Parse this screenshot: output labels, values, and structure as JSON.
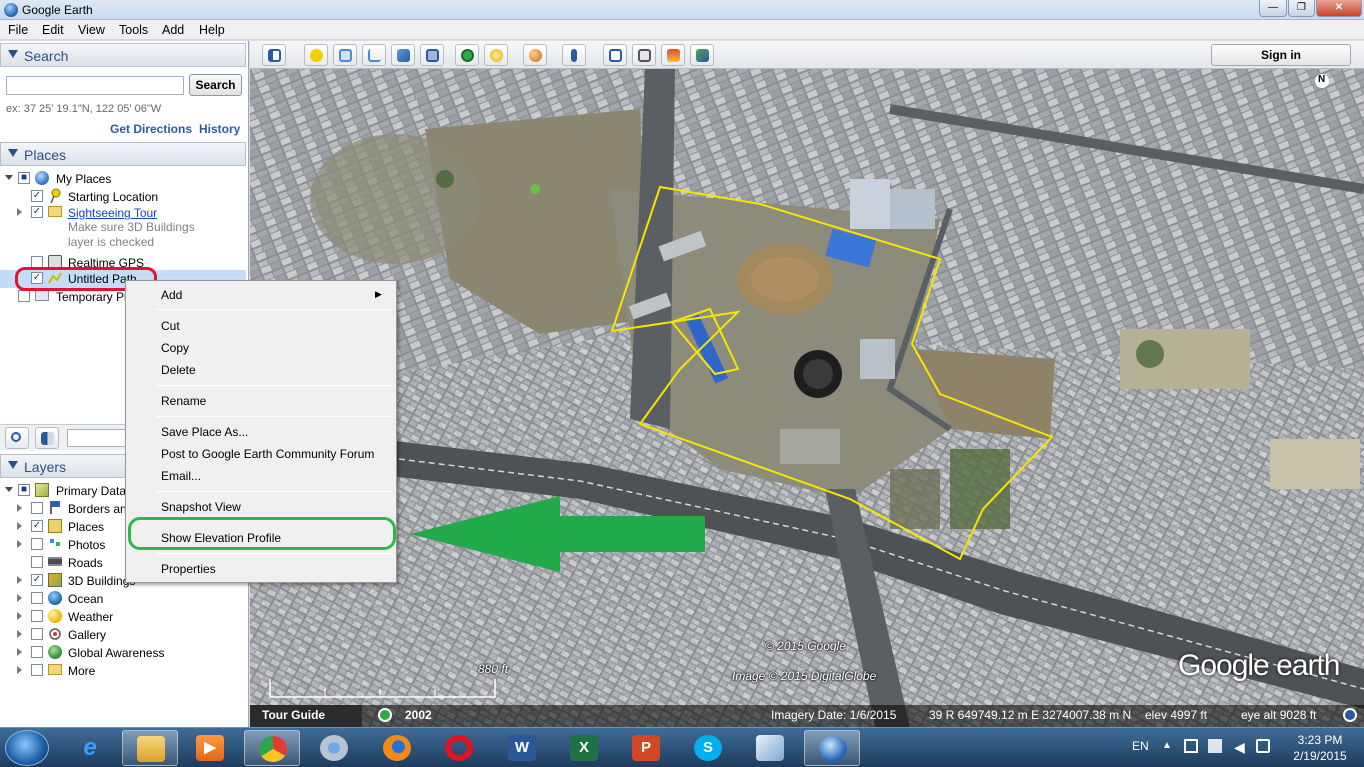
{
  "window": {
    "title": "Google Earth",
    "min": "—",
    "max": "❐",
    "close": "✕"
  },
  "menu": [
    "File",
    "Edit",
    "View",
    "Tools",
    "Add",
    "Help"
  ],
  "search": {
    "header": "Search",
    "button": "Search",
    "input_value": "",
    "hint": "ex: 37 25' 19.1\"N, 122 05' 06\"W",
    "get_directions": "Get Directions",
    "history": "History"
  },
  "places": {
    "header": "Places",
    "items": [
      {
        "label": "My Places"
      },
      {
        "label": "Starting Location"
      },
      {
        "label": "Sightseeing Tour"
      },
      {
        "label": "Make sure 3D Buildings"
      },
      {
        "label": "layer is checked"
      },
      {
        "label": "Realtime GPS"
      },
      {
        "label": "Untitled Path"
      },
      {
        "label": "Temporary Places"
      }
    ]
  },
  "layers": {
    "header": "Layers",
    "items": [
      {
        "label": "Primary Database"
      },
      {
        "label": "Borders and Labels"
      },
      {
        "label": "Places"
      },
      {
        "label": "Photos"
      },
      {
        "label": "Roads"
      },
      {
        "label": "3D Buildings"
      },
      {
        "label": "Ocean"
      },
      {
        "label": "Weather"
      },
      {
        "label": "Gallery"
      },
      {
        "label": "Global Awareness"
      },
      {
        "label": "More"
      }
    ]
  },
  "context_menu": {
    "items": [
      "Add",
      "Cut",
      "Copy",
      "Delete",
      "Rename",
      "Save Place As...",
      "Post to Google Earth Community Forum",
      "Email...",
      "Snapshot View",
      "Show Elevation Profile",
      "Properties"
    ],
    "submenu_arrow": "▶"
  },
  "toolbar": {
    "sign_in": "Sign in"
  },
  "map": {
    "compass": "N",
    "copyright_google": "© 2015 Google",
    "copyright_imagery": "Image © 2015 DigitalGlobe",
    "logo": "Google earth",
    "scale": "880 ft",
    "tour_guide": "Tour Guide",
    "historical_year": "2002",
    "imagery_date": "Imagery Date: 1/6/2015",
    "coordinates": "39 R 649749.12 m E 3274007.38 m N",
    "elev": "elev  4997 ft",
    "eye_alt": "eye alt  9028 ft"
  },
  "colors": {
    "path": "#f5e600",
    "highlight_red": "#e8102a",
    "highlight_green": "#2db84a",
    "arrow_green": "#21a94a"
  },
  "taskbar": {
    "language": "EN",
    "time": "3:23 PM",
    "date": "2/19/2015",
    "apps": [
      "start-orb",
      "internet-explorer",
      "file-explorer",
      "media-player",
      "chrome",
      "chrome-canary",
      "firefox",
      "opera",
      "word",
      "excel",
      "powerpoint",
      "skype",
      "google-earth-pro",
      "google-earth"
    ]
  }
}
